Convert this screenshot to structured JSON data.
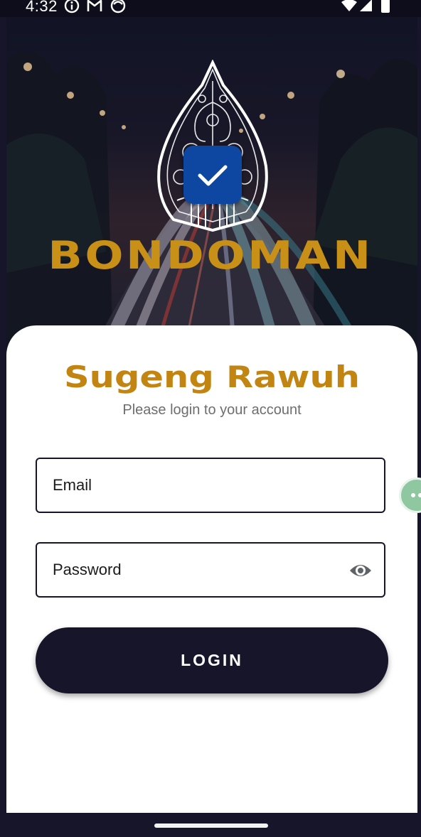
{
  "status_bar": {
    "time": "4:32",
    "icons_left": [
      "info-icon",
      "gmail-icon",
      "smiley-notification-icon"
    ],
    "icons_right": [
      "wifi-icon",
      "signal-icon",
      "battery-icon"
    ]
  },
  "hero": {
    "background": "night-highway-light-trails",
    "logo": "wayang-gunungan-icon",
    "badge_icon": "checkmark-icon",
    "brand_name": "BONDOMAN"
  },
  "login": {
    "title": "Sugeng Rawuh",
    "subtitle": "Please login to your account",
    "email_label": "Email",
    "password_label": "Password",
    "password_toggle_icon": "eye-icon",
    "button_label": "LOGIN"
  },
  "colors": {
    "brand_gold": "#c28512",
    "primary_dark": "#16152a",
    "badge_blue": "#0d47a1",
    "text_muted": "#6e6e6e"
  }
}
